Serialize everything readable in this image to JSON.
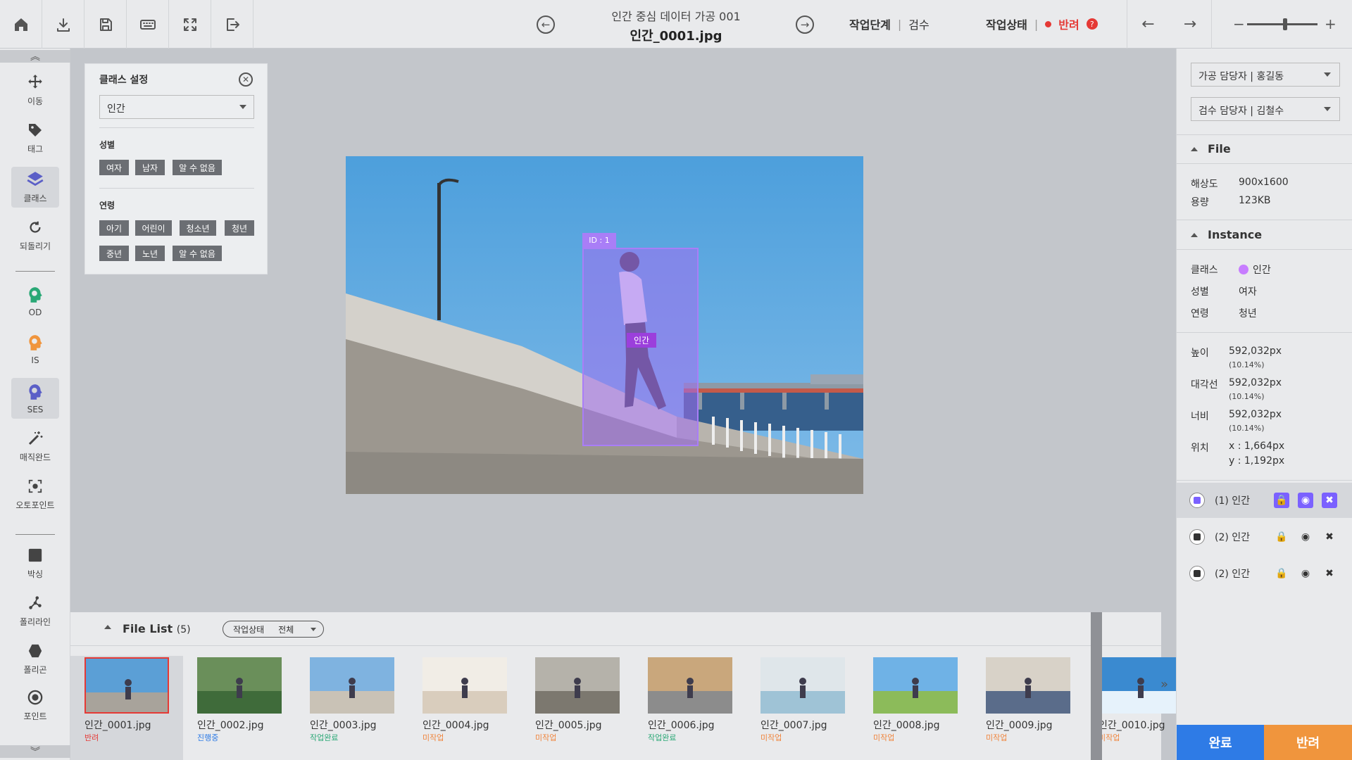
{
  "header": {
    "project_title": "인간 중심 데이터 가공 001",
    "file_name": "인간_0001.jpg",
    "stage_label": "작업단계",
    "stage_value": "검수",
    "status_label": "작업상태",
    "status_value": "반려",
    "status_help": "?",
    "zoom_level": 0.4
  },
  "left_tools": [
    {
      "label": "이동",
      "icon": "move-icon"
    },
    {
      "label": "태그",
      "icon": "tag-icon"
    },
    {
      "label": "클래스",
      "icon": "layers-icon",
      "active": true
    },
    {
      "label": "되돌리기",
      "icon": "undo-icon"
    },
    {
      "label": "OD",
      "icon": "od-ai-icon"
    },
    {
      "label": "IS",
      "icon": "is-ai-icon"
    },
    {
      "label": "SES",
      "icon": "ses-ai-icon",
      "active": true
    },
    {
      "label": "매직완드",
      "icon": "magic-wand-icon"
    },
    {
      "label": "오토포인트",
      "icon": "autopoint-icon"
    },
    {
      "label": "박싱",
      "icon": "box-icon"
    },
    {
      "label": "폴리라인",
      "icon": "polyline-icon"
    },
    {
      "label": "폴리곤",
      "icon": "polygon-icon"
    },
    {
      "label": "포인트",
      "icon": "point-icon"
    }
  ],
  "class_panel": {
    "title": "클래스 설정",
    "selected_class": "인간",
    "gender_label": "성별",
    "gender_options": [
      "여자",
      "남자",
      "알 수 없음"
    ],
    "age_label": "연령",
    "age_options": [
      "아기",
      "어린이",
      "청소년",
      "청년",
      "중년",
      "노년",
      "알 수 없음"
    ]
  },
  "canvas": {
    "bbox_id": "ID : 1",
    "bbox_class": "인간"
  },
  "file_list": {
    "title": "File List",
    "count": "(5)",
    "filter_label": "작업상태",
    "filter_value": "전체",
    "items": [
      {
        "name": "인간_0001.jpg",
        "status": "반려",
        "status_color": "#e53935"
      },
      {
        "name": "인간_0002.jpg",
        "status": "진행중",
        "status_color": "#2e7be6"
      },
      {
        "name": "인간_0003.jpg",
        "status": "작업완료",
        "status_color": "#2aa876"
      },
      {
        "name": "인간_0004.jpg",
        "status": "미작업",
        "status_color": "#f0853d"
      },
      {
        "name": "인간_0005.jpg",
        "status": "미작업",
        "status_color": "#f0853d"
      },
      {
        "name": "인간_0006.jpg",
        "status": "작업완료",
        "status_color": "#2aa876"
      },
      {
        "name": "인간_0007.jpg",
        "status": "미작업",
        "status_color": "#f0853d"
      },
      {
        "name": "인간_0008.jpg",
        "status": "미작업",
        "status_color": "#f0853d"
      },
      {
        "name": "인간_0009.jpg",
        "status": "미작업",
        "status_color": "#f0853d"
      },
      {
        "name": "인간_0010.jpg",
        "status": "미작업",
        "status_color": "#f0853d"
      }
    ]
  },
  "right_panel": {
    "worker_select": "가공 담당자 | 홍길동",
    "reviewer_select": "검수 담당자 | 김철수",
    "file_section": "File",
    "resolution_label": "해상도",
    "resolution_value": "900x1600",
    "size_label": "용량",
    "size_value": "123KB",
    "instance_section": "Instance",
    "class_label": "클래스",
    "class_value": "인간",
    "gender_label": "성별",
    "gender_value": "여자",
    "age_label": "연령",
    "age_value": "청년",
    "height_label": "높이",
    "height_value": "592,032px",
    "height_pct": "(10.14%)",
    "diag_label": "대각선",
    "diag_value": "592,032px",
    "diag_pct": "(10.14%)",
    "width_label": "너비",
    "width_value": "592,032px",
    "width_pct": "(10.14%)",
    "pos_label": "위치",
    "pos_x": "x : 1,664px",
    "pos_y": "y : 1,192px",
    "instances": [
      "(1) 인간",
      "(2) 인간",
      "(2) 인간"
    ]
  },
  "actions": {
    "complete": "완료",
    "reject": "반려"
  },
  "colors": {
    "accent_purple": "#a97ef7",
    "complete_blue": "#2e7be6",
    "reject_orange": "#f0953d",
    "status_red": "#e53935"
  }
}
